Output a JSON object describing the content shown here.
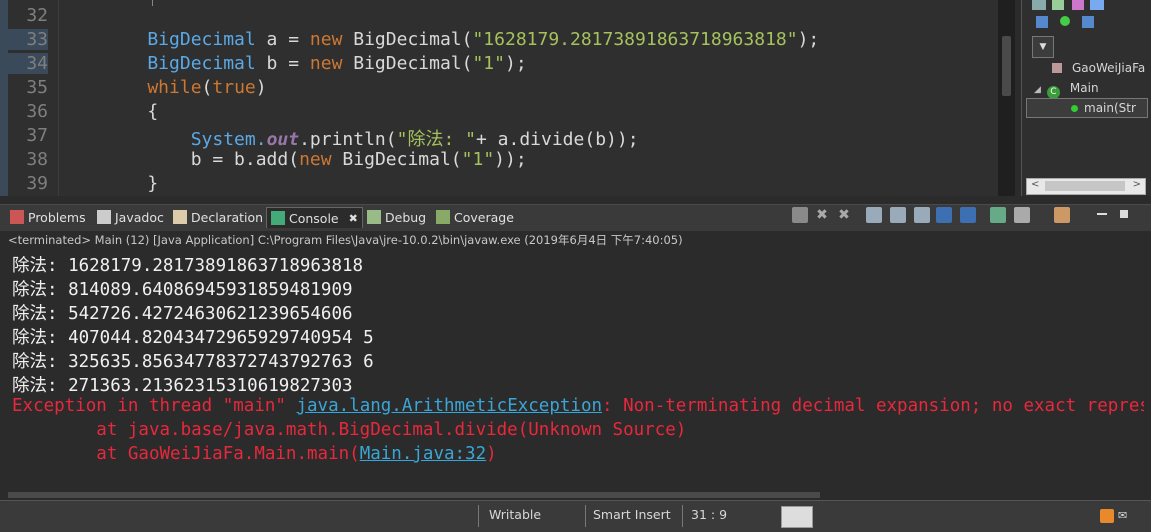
{
  "editor": {
    "line_numbers": [
      "32",
      "33",
      "34",
      "35",
      "36",
      "37",
      "38",
      "39"
    ],
    "lines": [
      {
        "parts": [
          {
            "t": "    ",
            "c": ""
          }
        ]
      },
      {
        "parts": [
          {
            "t": "    BigDecimal",
            "c": "ty"
          },
          {
            "t": " a = ",
            "c": ""
          },
          {
            "t": "new",
            "c": "kw"
          },
          {
            "t": " BigDecimal(",
            "c": ""
          },
          {
            "t": "\"1628179.28173891863718963818\"",
            "c": "st"
          },
          {
            "t": ");",
            "c": ""
          }
        ]
      },
      {
        "parts": [
          {
            "t": "    BigDecimal",
            "c": "ty"
          },
          {
            "t": " b = ",
            "c": ""
          },
          {
            "t": "new",
            "c": "kw"
          },
          {
            "t": " BigDecimal(",
            "c": ""
          },
          {
            "t": "\"1\"",
            "c": "st"
          },
          {
            "t": ");",
            "c": ""
          }
        ]
      },
      {
        "parts": [
          {
            "t": "    while",
            "c": "kw"
          },
          {
            "t": "(",
            "c": ""
          },
          {
            "t": "true",
            "c": "kw"
          },
          {
            "t": ")",
            "c": ""
          }
        ]
      },
      {
        "parts": [
          {
            "t": "    {",
            "c": ""
          }
        ]
      },
      {
        "parts": [
          {
            "t": "        System.",
            "c": "ty"
          },
          {
            "t": "out",
            "c": "fl"
          },
          {
            "t": ".println(",
            "c": ""
          },
          {
            "t": "\"除法: \"",
            "c": "st"
          },
          {
            "t": "+ a.divide(b));",
            "c": ""
          }
        ]
      },
      {
        "parts": [
          {
            "t": "        b = b.add(",
            "c": ""
          },
          {
            "t": "new",
            "c": "kw"
          },
          {
            "t": " BigDecimal(",
            "c": ""
          },
          {
            "t": "\"1\"",
            "c": "st"
          },
          {
            "t": "));",
            "c": ""
          }
        ]
      },
      {
        "parts": [
          {
            "t": "    }",
            "c": ""
          }
        ]
      }
    ]
  },
  "outline": {
    "items": [
      {
        "label": "GaoWeiJiaFa",
        "icon": "package-icon"
      },
      {
        "label": "Main",
        "icon": "class-icon"
      },
      {
        "label": "main(Str",
        "icon": "method-icon"
      }
    ]
  },
  "tabs": [
    {
      "label": "Problems",
      "icon": "problems-icon",
      "active": false
    },
    {
      "label": "Javadoc",
      "icon": "javadoc-icon",
      "active": false
    },
    {
      "label": "Declaration",
      "icon": "declaration-icon",
      "active": false
    },
    {
      "label": "Console",
      "icon": "console-icon",
      "active": true
    },
    {
      "label": "Debug",
      "icon": "debug-icon",
      "active": false
    },
    {
      "label": "Coverage",
      "icon": "coverage-icon",
      "active": false
    }
  ],
  "console": {
    "header": "<terminated> Main (12) [Java Application] C:\\Program Files\\Java\\jre-10.0.2\\bin\\javaw.exe (2019年6月4日 下午7:40:05)",
    "output": [
      "除法: 1628179.28173891863718963818",
      "除法: 814089.64086945931859481909",
      "除法: 542726.42724630621239654606",
      "除法: 407044.82043472965929740954 5",
      "除法: 325635.85634778372743792763 6",
      "除法: 271363.21362315310619827303"
    ],
    "exception": {
      "prefix": "Exception in thread \"main\" ",
      "class_link": "java.lang.ArithmeticException",
      "message": ": Non-terminating decimal expansion; no exact representable decimal result.",
      "trace1": "        at java.base/java.math.BigDecimal.divide(Unknown Source)",
      "trace2_prefix": "        at GaoWeiJiaFa.Main.main(",
      "trace2_link": "Main.java:32",
      "trace2_suffix": ")"
    }
  },
  "status": {
    "writable": "Writable",
    "insert_mode": "Smart Insert",
    "position": "31 : 9"
  }
}
